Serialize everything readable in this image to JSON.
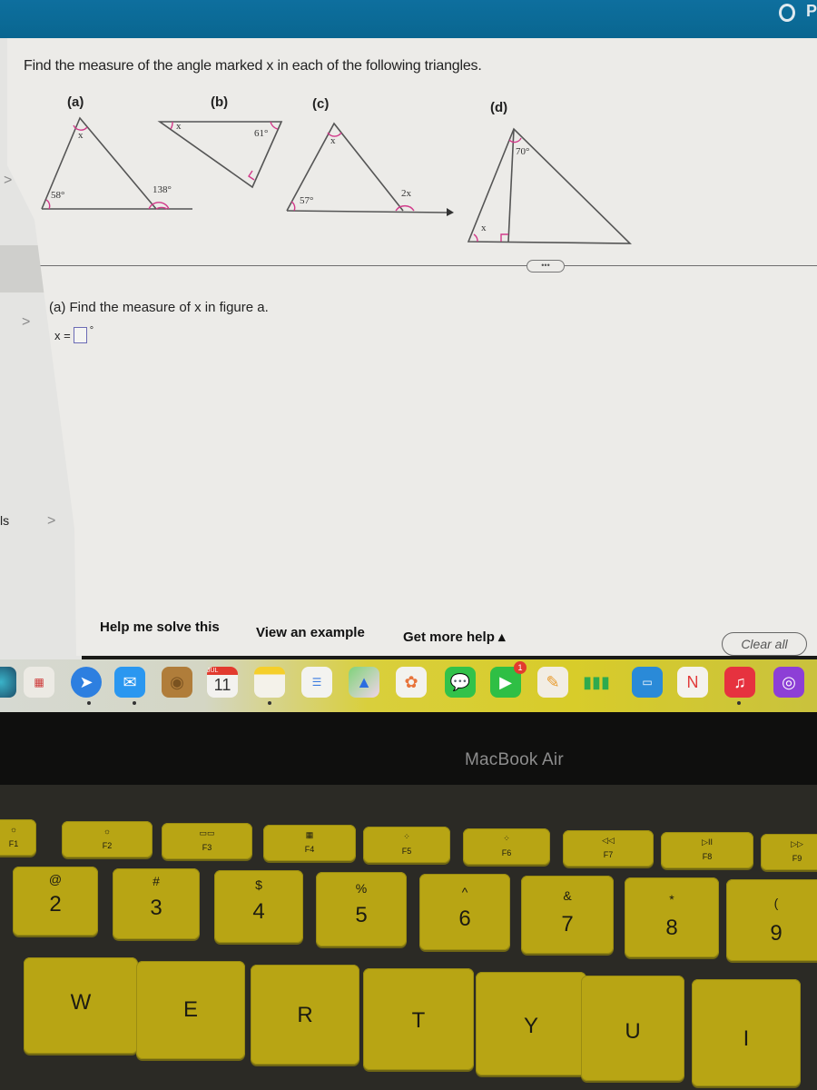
{
  "header": {
    "status_letter": "P"
  },
  "sidebar": {
    "items": [
      {
        "label": "",
        "chevron": ">"
      },
      {
        "label": "",
        "chevron": ">"
      },
      {
        "label": "ls",
        "chevron": ">"
      }
    ]
  },
  "problem": {
    "instructions": "Find the measure of the angle marked x in each of the following triangles.",
    "figures": [
      {
        "label": "(a)",
        "angles": [
          "x",
          "58°",
          "138°"
        ]
      },
      {
        "label": "(b)",
        "angles": [
          "x",
          "61°",
          "right angle"
        ]
      },
      {
        "label": "(c)",
        "angles": [
          "x",
          "57°",
          "2x"
        ]
      },
      {
        "label": "(d)",
        "angles": [
          "70°",
          "x",
          "right angle"
        ]
      }
    ],
    "more_button": "•••",
    "question": "(a) Find the measure of x in figure a.",
    "answer_prefix": "x =",
    "answer_value": "",
    "answer_suffix": "°"
  },
  "help": {
    "help_me_solve": "Help me solve this",
    "view_example": "View an example",
    "get_more_help": "Get more help ▴",
    "clear_all": "Clear all"
  },
  "dock": {
    "apps": [
      {
        "name": "Siri",
        "icon": "siri-icon"
      },
      {
        "name": "Launchpad",
        "icon": "launchpad-icon"
      },
      {
        "name": "Safari",
        "icon": "safari-icon",
        "running": true
      },
      {
        "name": "Mail",
        "icon": "mail-icon",
        "running": true
      },
      {
        "name": "Contacts",
        "icon": "contacts-icon"
      },
      {
        "name": "Calendar",
        "icon": "calendar-icon",
        "month": "JUL",
        "day": "11"
      },
      {
        "name": "Notes",
        "icon": "notes-icon",
        "running": true
      },
      {
        "name": "Reminders",
        "icon": "reminders-icon"
      },
      {
        "name": "Maps",
        "icon": "maps-icon"
      },
      {
        "name": "Photos",
        "icon": "photos-icon"
      },
      {
        "name": "Messages",
        "icon": "messages-icon"
      },
      {
        "name": "FaceTime",
        "icon": "facetime-icon",
        "badge": "1"
      },
      {
        "name": "Pages",
        "icon": "pages-icon"
      },
      {
        "name": "Numbers",
        "icon": "numbers-icon"
      },
      {
        "name": "Keynote",
        "icon": "keynote-icon"
      },
      {
        "name": "News",
        "icon": "news-icon"
      },
      {
        "name": "Music",
        "icon": "music-icon",
        "running": true
      },
      {
        "name": "Podcasts",
        "icon": "podcasts-icon"
      }
    ]
  },
  "device": {
    "brand": "MacBook Air"
  },
  "keyboard": {
    "fn_row": [
      {
        "glyph": "☼",
        "label": "F1"
      },
      {
        "glyph": "☼",
        "label": "F2"
      },
      {
        "glyph": "▭▭",
        "label": "F3"
      },
      {
        "glyph": "▦",
        "label": "F4"
      },
      {
        "glyph": "⁘",
        "label": "F5"
      },
      {
        "glyph": "⁘",
        "label": "F6"
      },
      {
        "glyph": "◁◁",
        "label": "F7"
      },
      {
        "glyph": "▷II",
        "label": "F8"
      },
      {
        "glyph": "▷▷",
        "label": "F9"
      }
    ],
    "number_row": [
      {
        "sym": "@",
        "main": "2"
      },
      {
        "sym": "#",
        "main": "3"
      },
      {
        "sym": "$",
        "main": "4"
      },
      {
        "sym": "%",
        "main": "5"
      },
      {
        "sym": "^",
        "main": "6"
      },
      {
        "sym": "&",
        "main": "7"
      },
      {
        "sym": "*",
        "main": "8"
      },
      {
        "sym": "(",
        "main": "9"
      }
    ],
    "letter_row": [
      "W",
      "E",
      "R",
      "T",
      "Y",
      "U",
      "I"
    ]
  },
  "colors": {
    "header_blue": "#0b6a96",
    "angle_marker": "#d23a8a",
    "key_yellow": "#b8a514"
  }
}
